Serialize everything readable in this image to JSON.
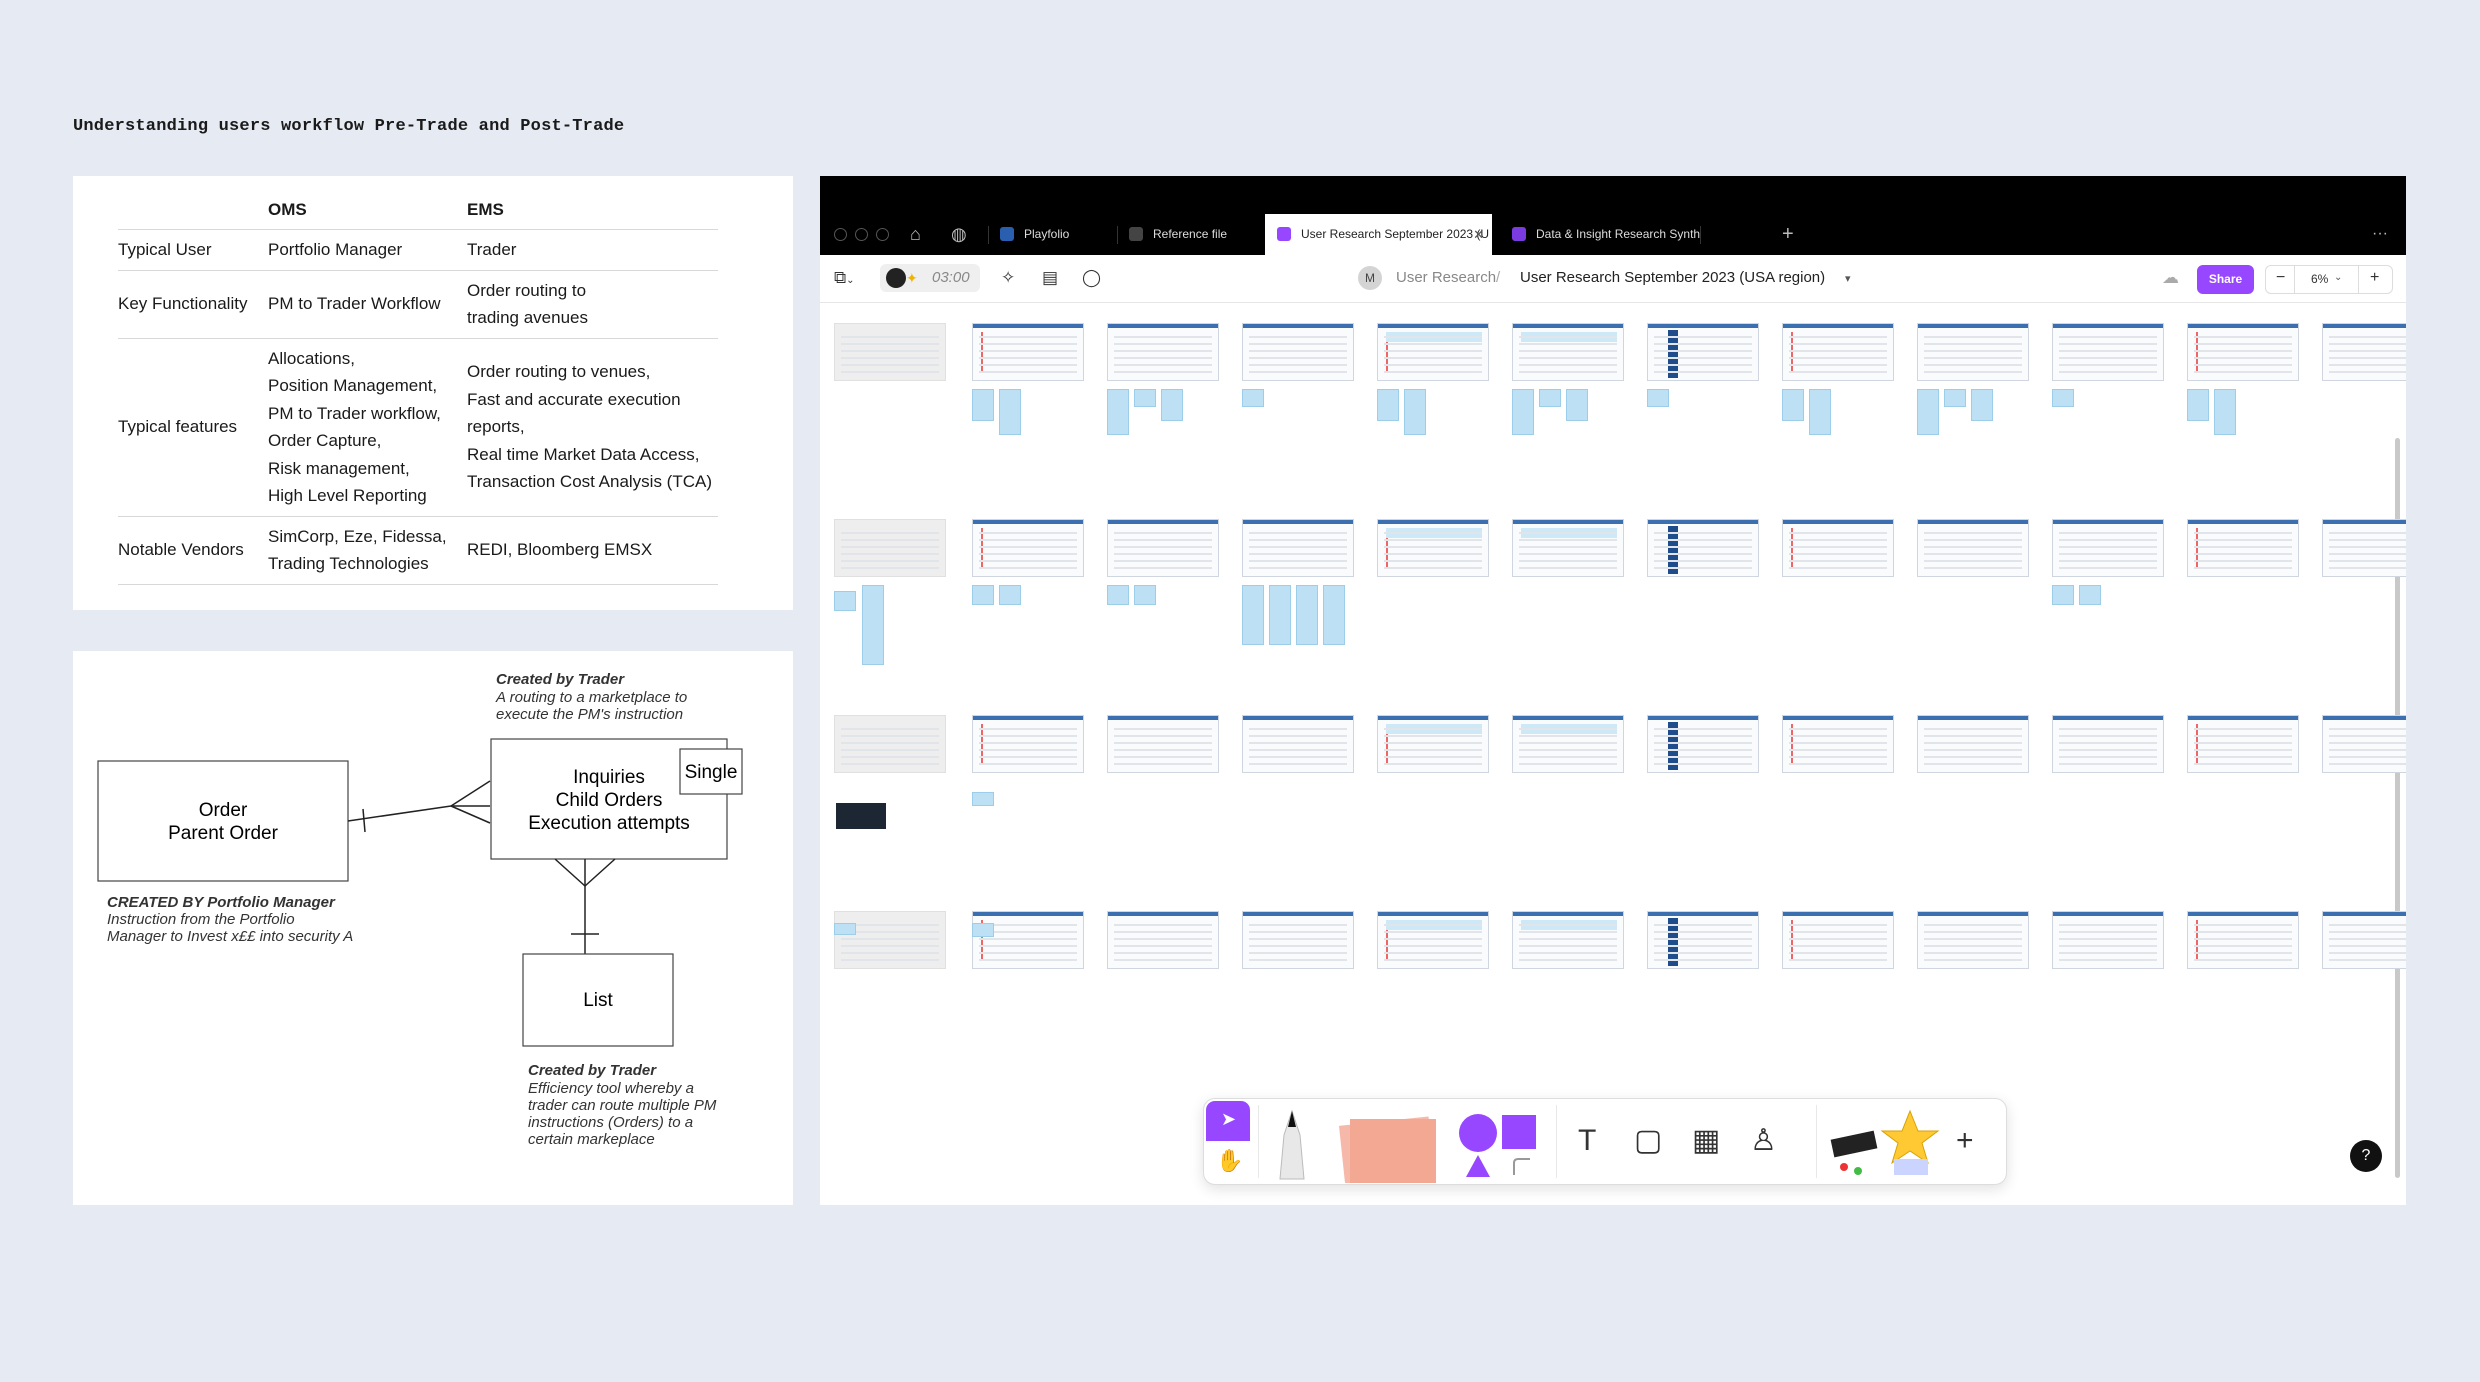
{
  "page_heading": "Understanding users workflow Pre-Trade and Post-Trade",
  "comparison": {
    "headers": [
      "",
      "OMS",
      "EMS"
    ],
    "rows": [
      {
        "label": "Typical User",
        "oms": [
          "Portfolio Manager"
        ],
        "ems": [
          "Trader"
        ]
      },
      {
        "label": "Key Functionality",
        "oms": [
          "PM to Trader Workflow"
        ],
        "ems": [
          "Order routing to",
          "trading avenues"
        ]
      },
      {
        "label": "Typical features",
        "oms": [
          "Allocations,",
          "Position Management,",
          "PM to Trader workflow,",
          "Order Capture,",
          "Risk management,",
          "High Level Reporting"
        ],
        "ems": [
          "Order routing to venues,",
          "Fast and accurate execution",
          "reports,",
          "Real time Market Data Access,",
          "Transaction Cost Analysis (TCA)"
        ]
      },
      {
        "label": "Notable Vendors",
        "oms": [
          "SimCorp, Eze, Fidessa,",
          "Trading Technologies"
        ],
        "ems": [
          "REDI, Bloomberg EMSX"
        ]
      }
    ]
  },
  "diagram": {
    "order_box": [
      "Order",
      "Parent Order"
    ],
    "order_note_title": "CREATED BY Portfolio Manager",
    "order_note_lines": [
      "Instruction from the Portfolio",
      "Manager to Invest x££ into security A"
    ],
    "inquiries_box": [
      "Inquiries",
      "Child Orders",
      "Execution attempts"
    ],
    "single_label": "Single",
    "inquiries_note_title": "Created by Trader",
    "inquiries_note_lines": [
      "A routing to a marketplace to",
      "execute the PM's instruction"
    ],
    "list_box": "List",
    "list_note_title": "Created by Trader",
    "list_note_lines": [
      "Efficiency tool whereby a",
      "trader can route multiple PM",
      "instructions (Orders) to a",
      "certain markeplace"
    ]
  },
  "figma": {
    "tabs": [
      {
        "label": "Playfolio",
        "active": false,
        "color": "#2a5fb0"
      },
      {
        "label": "Reference file",
        "active": false,
        "color": "#444444"
      },
      {
        "label": "User Research September 2023 (U",
        "active": true,
        "color": "#9747ff"
      },
      {
        "label": "Data & Insight Research Synth",
        "active": false,
        "color": "#7a3ce0"
      }
    ],
    "new_tab": "+",
    "more": "···",
    "timer": "03:00",
    "user_initial": "M",
    "breadcrumb_project": "User Research",
    "breadcrumb_sep": "/",
    "file_name": "User Research September 2023 (USA region)",
    "share_label": "Share",
    "zoom": "6%",
    "zoom_minus": "−",
    "zoom_plus": "+",
    "help": "?",
    "icons": [
      "home-icon",
      "globe-icon",
      "figma-menu-icon",
      "ai-sparkle-icon",
      "layout-icon",
      "comment-icon",
      "cloud-icon",
      "chevron-down-icon",
      "cursor-icon",
      "hand-icon",
      "pen-icon",
      "sticky-note-icon",
      "shapes-icon",
      "text-icon",
      "section-icon",
      "table-icon",
      "stamp-icon",
      "widgets-icon",
      "plus-icon"
    ],
    "accent": "#9747ff"
  }
}
